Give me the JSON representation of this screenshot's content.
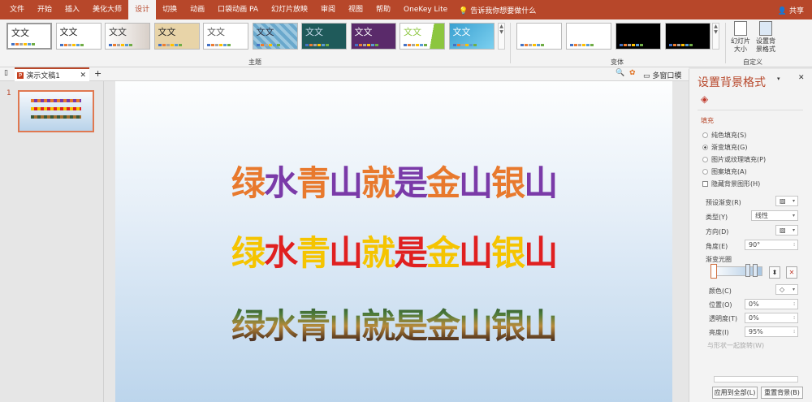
{
  "menu": {
    "tabs": [
      "文件",
      "开始",
      "插入",
      "美化大师",
      "设计",
      "切换",
      "动画",
      "口袋动画 PA",
      "幻灯片放映",
      "审阅",
      "视图",
      "帮助",
      "OneKey Lite"
    ],
    "active": "设计",
    "tell_me": "告诉我你想要做什么",
    "share": "共享"
  },
  "ribbon": {
    "theme_sample": "文文",
    "themes_group": "主题",
    "variants_group": "变体",
    "customize_group": "自定义",
    "slide_size": "幻灯片大小",
    "format_background": "设置背景格式"
  },
  "tabstrip": {
    "doc_name": "演示文稿1",
    "multi_window": "多窗口模式"
  },
  "slides": {
    "number": "1"
  },
  "slide": {
    "lines": [
      "绿水青山就是金山银山",
      "绿水青山就是金山银山",
      "绿水青山就是金山银山"
    ]
  },
  "pane": {
    "title": "设置背景格式",
    "fill_section": "填充",
    "options": [
      "纯色填充(S)",
      "渐变填充(G)",
      "图片或纹理填充(P)",
      "图案填充(A)"
    ],
    "hide_bg": "隐藏背景图形(H)",
    "preset_label": "预设渐变(R)",
    "type_label": "类型(Y)",
    "type_value": "线性",
    "direction_label": "方向(D)",
    "angle_label": "角度(E)",
    "angle_value": "90°",
    "stops_label": "渐变光圈",
    "color_label": "颜色(C)",
    "position_label": "位置(O)",
    "position_value": "0%",
    "transparency_label": "透明度(T)",
    "transparency_value": "0%",
    "brightness_label": "亮度(I)",
    "brightness_value": "95%",
    "rotate_label": "与形状一起旋转(W)",
    "apply_all": "应用到全部(L)",
    "reset": "重置背景(B)"
  }
}
